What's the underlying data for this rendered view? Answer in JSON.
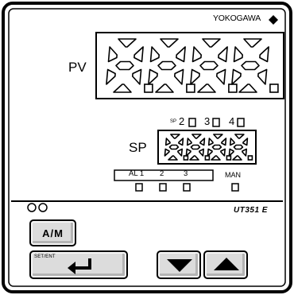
{
  "brand": "YOKOGAWA",
  "model": "UT351 E",
  "pv_label": "PV",
  "sp_label": "SP",
  "sp_indicators": {
    "sp_prefix": "SP",
    "sp2": "2",
    "sp3": "3",
    "sp4": "4"
  },
  "al_labels": {
    "al1": "AL 1",
    "al2": "2",
    "al3": "3",
    "man": "MAN"
  },
  "buttons": {
    "am": "A/M",
    "set_ent_small": "SET/ENT"
  },
  "icons": {
    "brand_mark": "diamond-icon",
    "enter": "enter-arrow-icon",
    "down": "down-triangle-icon",
    "up": "up-triangle-icon",
    "status": "status-led-icon"
  },
  "colors": {
    "panel_bg": "#ffffff",
    "outline": "#000000",
    "button_face": "#dcdcdc"
  }
}
